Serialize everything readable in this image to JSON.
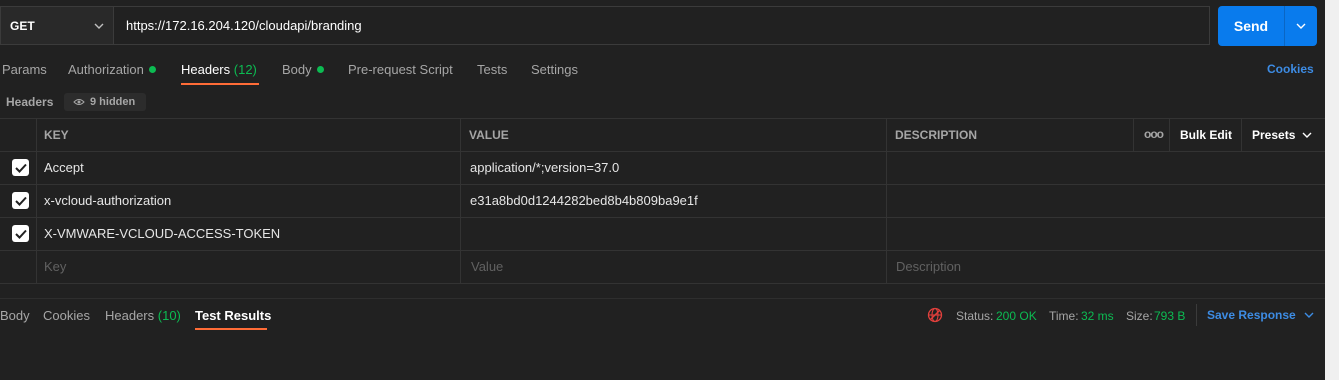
{
  "request": {
    "method": "GET",
    "url": "https://172.16.204.120/cloudapi/branding",
    "send_label": "Send"
  },
  "req_tabs": {
    "params": "Params",
    "authorization": "Authorization",
    "headers": "Headers",
    "headers_count": "(12)",
    "body": "Body",
    "prerequest": "Pre-request Script",
    "tests": "Tests",
    "settings": "Settings",
    "cookies": "Cookies"
  },
  "headers_section": {
    "label": "Headers",
    "hidden": "9 hidden"
  },
  "table": {
    "col_key": "KEY",
    "col_value": "VALUE",
    "col_description": "DESCRIPTION",
    "more": "ooo",
    "bulk_edit": "Bulk Edit",
    "presets": "Presets",
    "rows": [
      {
        "key": "Accept",
        "value": "application/*;version=37.0",
        "checked": true
      },
      {
        "key": "x-vcloud-authorization",
        "value": "e31a8bd0d1244282bed8b4b809ba9e1f",
        "checked": true
      },
      {
        "key": "X-VMWARE-VCLOUD-ACCESS-TOKEN",
        "value": "",
        "checked": true
      }
    ],
    "placeholder_key": "Key",
    "placeholder_value": "Value",
    "placeholder_description": "Description"
  },
  "response": {
    "tab_body": "Body",
    "tab_cookies": "Cookies",
    "tab_headers": "Headers",
    "tab_headers_count": "(10)",
    "tab_test_results": "Test Results",
    "status_label": "Status:",
    "status_value": "200 OK",
    "time_label": "Time:",
    "time_value": "32 ms",
    "size_label": "Size:",
    "size_value": "793 B",
    "save_response": "Save Response"
  },
  "colors": {
    "accent": "#ff6c37",
    "send": "#097bed",
    "ok": "#0cbb52",
    "link": "#3d8ce4"
  }
}
